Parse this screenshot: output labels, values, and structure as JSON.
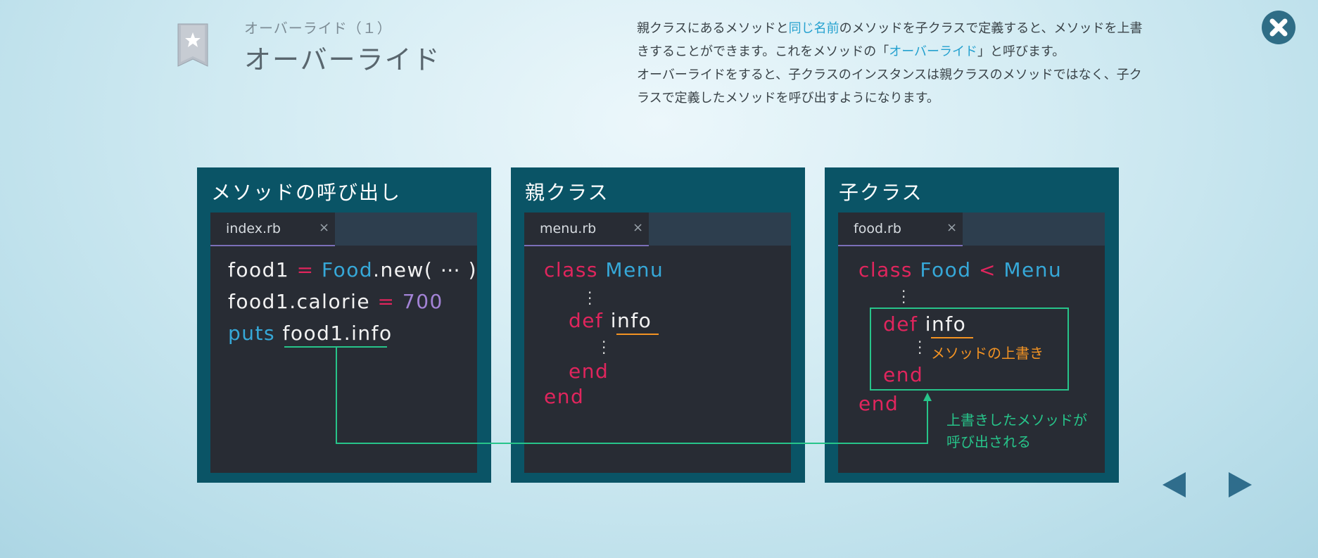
{
  "header": {
    "subtitle": "オーバーライド（１）",
    "title": "オーバーライド"
  },
  "description": {
    "p1_a": "親クラスにあるメソッドと",
    "p1_hl1": "同じ名前",
    "p1_b": "のメソッドを子クラスで定義すると、メソッドを上書きすることができます。これをメソッドの「",
    "p1_hl2": "オーバーライド",
    "p1_c": "」と呼びます。",
    "p2": "オーバーライドをすると、子クラスのインスタンスは親クラスのメソッドではなく、子クラスで定義したメソッドを呼び出すようになります。"
  },
  "panels": [
    {
      "title": "メソッドの呼び出し",
      "tab": "index.rb",
      "close": "×",
      "code": {
        "l1_var": "food1",
        "l1_eq": "=",
        "l1_cls": "Food",
        "l1_rest": ".new( ⋯ )",
        "l2_var": "food1.calorie",
        "l2_eq": "=",
        "l2_num": "700",
        "l3_kw": "puts",
        "l3_call": "food1.info"
      }
    },
    {
      "title": "親クラス",
      "tab": "menu.rb",
      "close": "×",
      "code": {
        "class_kw": "class",
        "class_name": "Menu",
        "def_kw": "def",
        "method": "info",
        "end_inner": "end",
        "end_outer": "end"
      }
    },
    {
      "title": "子クラス",
      "tab": "food.rb",
      "close": "×",
      "code": {
        "class_kw": "class",
        "class_name": "Food",
        "lt": "<",
        "parent": "Menu",
        "def_kw": "def",
        "method": "info",
        "note": "メソッドの上書き",
        "end_inner": "end",
        "end_outer": "end"
      },
      "callout": "上書きしたメソッドが呼び出される"
    }
  ],
  "icons": {
    "bookmark": "star-bookmark-icon",
    "close": "close-icon",
    "prev": "prev-arrow-icon",
    "next": "next-arrow-icon"
  },
  "colors": {
    "keyword": "#e0255d",
    "class": "#36a8d8",
    "number": "#a383d6",
    "note": "#f39323",
    "highlight": "#27c48a",
    "panel": "#0a5466",
    "editor": "#282c34"
  }
}
